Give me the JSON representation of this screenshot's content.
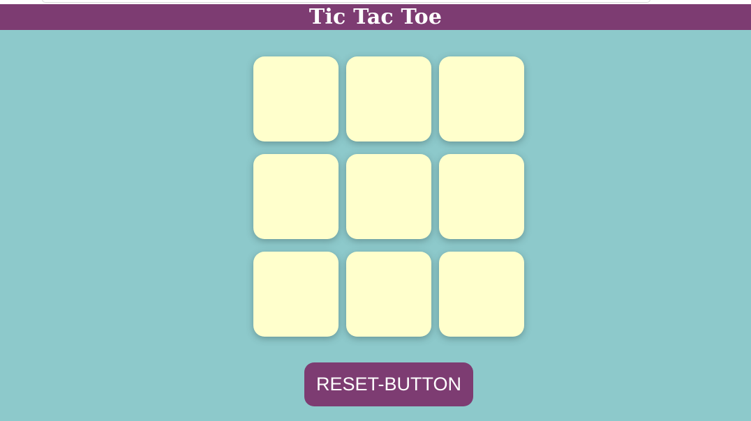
{
  "header": {
    "title": "Tic Tac Toe"
  },
  "board": {
    "cells": [
      "",
      "",
      "",
      "",
      "",
      "",
      "",
      "",
      ""
    ]
  },
  "controls": {
    "reset_label": "RESET-BUTTON"
  },
  "colors": {
    "background": "#8dc9cb",
    "header": "#7d3c72",
    "cell": "#ffffcc",
    "button": "#7d3c72",
    "text_light": "#ffffff"
  }
}
